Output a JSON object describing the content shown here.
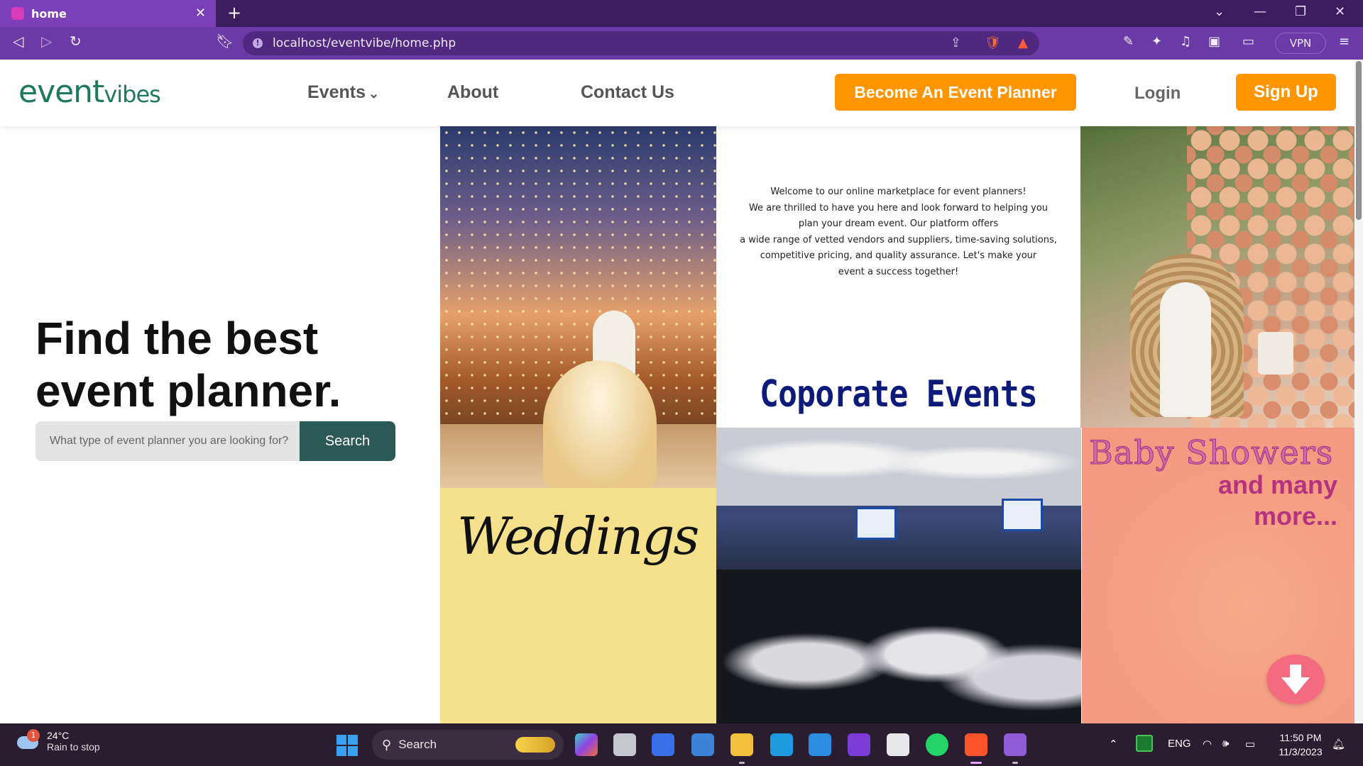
{
  "browser": {
    "tab_title": "home",
    "tab_close": "✕",
    "new_tab": "+",
    "url": "localhost/eventvibe/home.php",
    "vpn_label": "VPN",
    "accent_color": "#6a3aa6"
  },
  "site": {
    "logo_main": "event",
    "logo_small": "vibes",
    "nav": {
      "events": "Events",
      "about": "About",
      "contact": "Contact Us"
    },
    "become_planner": "Become An Event Planner",
    "login": "Login",
    "signup": "Sign Up",
    "brand_orange": "#ff9500",
    "brand_green": "#2b5a56"
  },
  "hero": {
    "title_line1": "Find the best",
    "title_line2": "event planner.",
    "search_placeholder": "What type of event planner you are looking for?",
    "search_button": "Search"
  },
  "collage": {
    "weddings_label": "Weddings",
    "welcome_lines": [
      "Welcome to our online marketplace for event planners!",
      "We are thrilled to have you here and look forward to helping you",
      "plan your dream event. Our platform offers",
      "a wide range of vetted vendors and suppliers, time-saving solutions,",
      "competitive pricing, and quality assurance. Let's make your",
      "event a success together!"
    ],
    "corporate_label": "Coporate Events",
    "baby_line1": "Baby Showers",
    "baby_line2": "and many",
    "baby_line3": "more..."
  },
  "taskbar": {
    "weather_temp": "24°C",
    "weather_condition": "Rain to stop",
    "weather_badge": "1",
    "search_label": "Search",
    "language": "ENG",
    "time": "11:50 PM",
    "date": "11/3/2023"
  }
}
